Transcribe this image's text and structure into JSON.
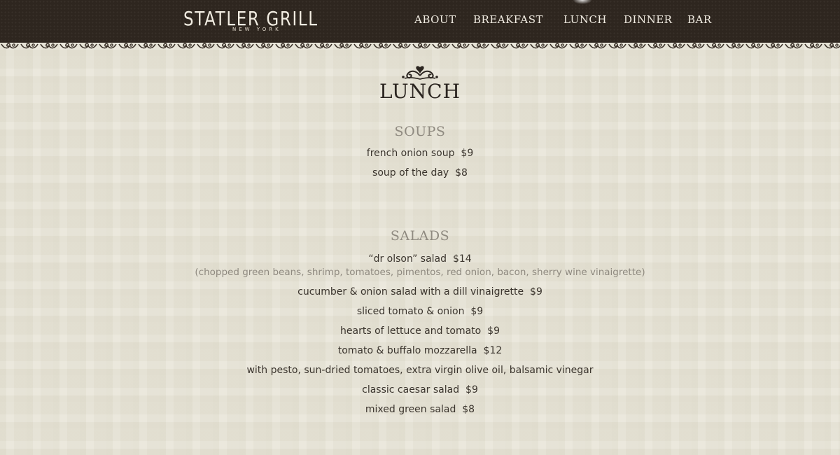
{
  "header": {
    "logo_text": "STATLER GRILL",
    "logo_subtext": "NEW YORK",
    "nav": [
      {
        "label": "ABOUT"
      },
      {
        "label": "BREAKFAST"
      },
      {
        "label": "LUNCH"
      },
      {
        "label": "DINNER"
      },
      {
        "label": "BAR"
      }
    ]
  },
  "page": {
    "title": "LUNCH"
  },
  "sections": [
    {
      "heading": "SOUPS",
      "items": [
        {
          "name": "french onion soup",
          "price": "$9"
        },
        {
          "name": "soup of the day",
          "price": "$8"
        }
      ]
    },
    {
      "heading": "SALADS",
      "items": [
        {
          "name": "“dr olson” salad",
          "price": "$14"
        },
        {
          "name": "(chopped green beans, shrimp, tomatoes, pimentos, red onion, bacon, sherry wine vinaigrette)"
        },
        {
          "name": "cucumber & onion salad with a dill vinaigrette",
          "price": "$9"
        },
        {
          "name": "sliced tomato & onion",
          "price": "$9"
        },
        {
          "name": "hearts of lettuce and tomato",
          "price": "$9"
        },
        {
          "name": "tomato & buffalo mozzarella",
          "price": "$12"
        },
        {
          "name": "with pesto, sun-dried tomatoes, extra virgin olive oil, balsamic vinegar"
        },
        {
          "name": "classic caesar salad",
          "price": "$9"
        },
        {
          "name": "mixed green salad",
          "price": "$8"
        }
      ]
    }
  ],
  "colors": {
    "header_bg": "#2e261f",
    "page_bg": "#e9e6d9",
    "heading_gray": "#8f8a80",
    "text_dark": "#3a342d"
  }
}
